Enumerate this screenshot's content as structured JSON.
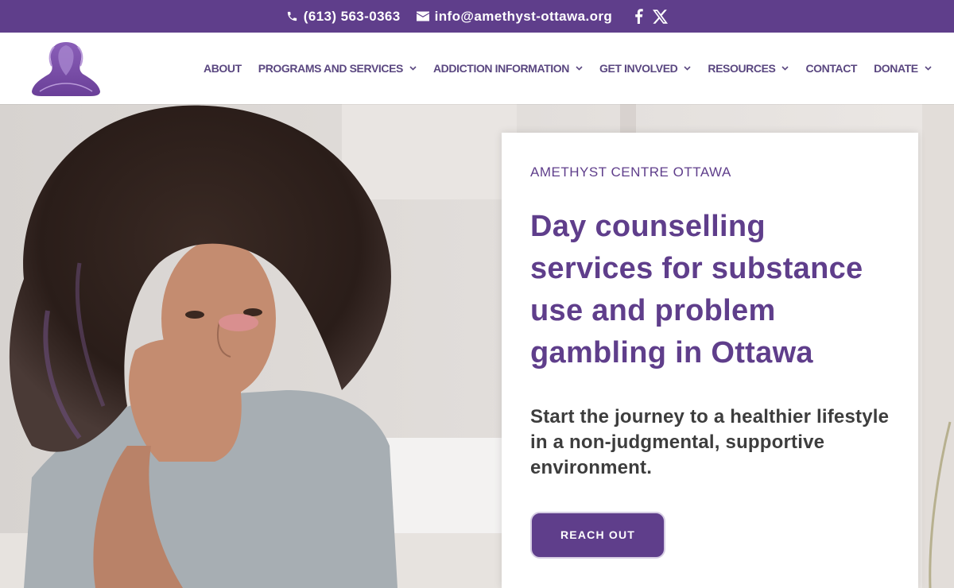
{
  "topbar": {
    "phone": "(613) 563-0363",
    "email": "info@amethyst-ottawa.org",
    "social": [
      {
        "icon": "facebook-icon"
      },
      {
        "icon": "x-twitter-icon"
      }
    ]
  },
  "nav": {
    "items": [
      {
        "label": "ABOUT",
        "has_dropdown": false
      },
      {
        "label": "PROGRAMS AND SERVICES",
        "has_dropdown": true
      },
      {
        "label": "ADDICTION INFORMATION",
        "has_dropdown": true
      },
      {
        "label": "GET INVOLVED",
        "has_dropdown": true
      },
      {
        "label": "RESOURCES",
        "has_dropdown": true
      },
      {
        "label": "CONTACT",
        "has_dropdown": false
      },
      {
        "label": "DONATE",
        "has_dropdown": true
      }
    ]
  },
  "hero": {
    "eyebrow": "AMETHYST CENTRE OTTAWA",
    "headline": "Day counselling services for substance use and problem gambling in Ottawa",
    "subtext": "Start the journey to a healthier lifestyle in a non-judgmental, supportive environment.",
    "cta_label": "REACH OUT"
  },
  "colors": {
    "brand_purple": "#5f3e8b",
    "nav_text": "#5a4780",
    "body_text": "#3d3d3d"
  }
}
